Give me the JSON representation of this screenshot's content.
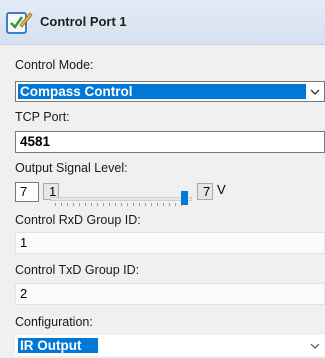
{
  "header": {
    "title": "Control Port 1",
    "icon": "checklist-pencil-icon"
  },
  "control_mode": {
    "label": "Control Mode:",
    "value": "Compass Control"
  },
  "tcp_port": {
    "label": "TCP Port:",
    "value": "4581"
  },
  "output_signal": {
    "label": "Output Signal Level:",
    "value": "7",
    "min": "1",
    "max": "7",
    "unit": "V",
    "slider_fraction": 1.0
  },
  "rxd_group": {
    "label": "Control RxD Group ID:",
    "value": "1"
  },
  "txd_group": {
    "label": "Control TxD Group ID:",
    "value": "2"
  },
  "configuration": {
    "label": "Configuration:",
    "value": "IR Output"
  },
  "colors": {
    "selection": "#0078d7",
    "header": "#dbe4f0"
  }
}
